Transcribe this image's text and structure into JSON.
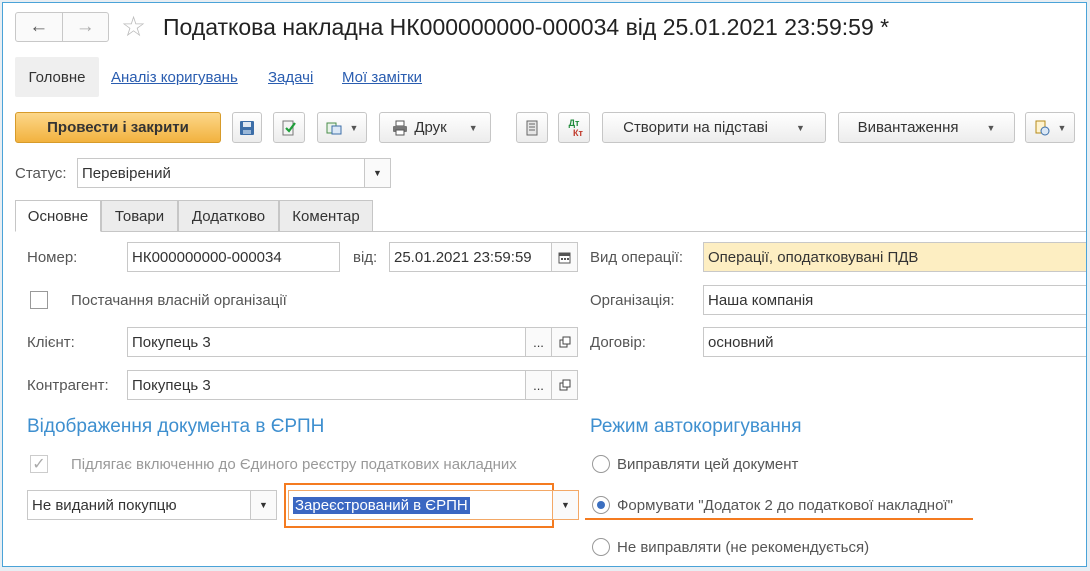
{
  "window": {
    "title": "Податкова накладна НК000000000-000034 від 25.01.2021 23:59:59 *"
  },
  "nav_tabs": {
    "main": "Головне",
    "analysis": "Аналіз коригувань",
    "tasks": "Задачі",
    "notes": "Мої замітки"
  },
  "toolbar": {
    "post_close": "Провести і закрити",
    "print": "Друк",
    "create_based": "Створити на підставі",
    "export": "Вивантаження"
  },
  "status": {
    "label": "Статус:",
    "value": "Перевірений"
  },
  "tabs": [
    "Основне",
    "Товари",
    "Додатково",
    "Коментар"
  ],
  "form": {
    "number_label": "Номер:",
    "number_value": "НК000000000-000034",
    "date_label": "від:",
    "date_value": "25.01.2021 23:59:59",
    "operation_label": "Вид операції:",
    "operation_value": "Операції, оподатковувані ПДВ",
    "own_org_label": "Постачання власній організації",
    "organization_label": "Організація:",
    "organization_value": "Наша компанія",
    "client_label": "Клієнт:",
    "client_value": "Покупець 3",
    "contract_label": "Договір:",
    "contract_value": "основний",
    "counterparty_label": "Контрагент:",
    "counterparty_value": "Покупець 3"
  },
  "erpn": {
    "section_title": "Відображення документа в ЄРПН",
    "include_label": "Підлягає включенню до Єдиного реєстру податкових накладних",
    "include_checked": true,
    "issue_value": "Не виданий покупцю",
    "reg_value": "Зареєстрований в ЄРПН"
  },
  "autocorr": {
    "section_title": "Режим автокоригування",
    "options": [
      "Виправляти цей документ",
      "Формувати \"Додаток 2 до податкової накладної\"",
      "Не виправляти (не рекомендується)"
    ],
    "selected_index": 1
  },
  "symbols": {
    "back": "←",
    "forward": "→",
    "star": "☆",
    "caret": "▼",
    "ellipsis": "...",
    "check": "✓",
    "dtkt_top": "Дт",
    "dtkt_bottom": "Кт"
  },
  "colors": {
    "accent": "#f2b23f",
    "section_title": "#3e8fcf",
    "link": "#2a5db0",
    "highlight_orange": "#f47b20",
    "selection_blue": "#3a67c2"
  }
}
